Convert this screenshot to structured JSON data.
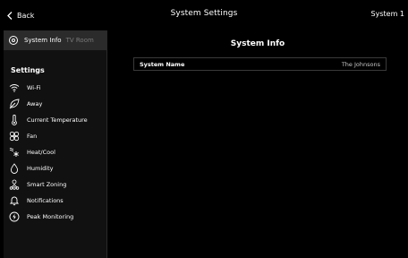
{
  "header": {
    "back_label": "Back",
    "title": "System Settings",
    "system_label": "System 1"
  },
  "sidebar": {
    "tabs": [
      {
        "label": "System Info",
        "icon": "target-icon",
        "selected": true
      },
      {
        "label": "TV Room",
        "selected": false
      }
    ],
    "section_title": "Settings",
    "items": [
      {
        "label": "Wi-Fi",
        "icon": "wifi-icon"
      },
      {
        "label": "Away",
        "icon": "leaf-icon"
      },
      {
        "label": "Current Temperature",
        "icon": "thermometer-icon"
      },
      {
        "label": "Fan",
        "icon": "fan-icon"
      },
      {
        "label": "Heat/Cool",
        "icon": "heat-cool-icon"
      },
      {
        "label": "Humidity",
        "icon": "droplet-icon"
      },
      {
        "label": "Smart Zoning",
        "icon": "zoning-icon"
      },
      {
        "label": "Notifications",
        "icon": "bell-icon"
      },
      {
        "label": "Peak Monitoring",
        "icon": "lightning-icon"
      }
    ]
  },
  "main": {
    "title": "System Info",
    "fields": [
      {
        "label": "System Name",
        "value": "The Johnsons"
      }
    ]
  },
  "colors": {
    "background": "#000000",
    "sidebar": "#111111",
    "tab_strip": "#2b2b2b",
    "inactive_text": "#7a7a7a"
  }
}
